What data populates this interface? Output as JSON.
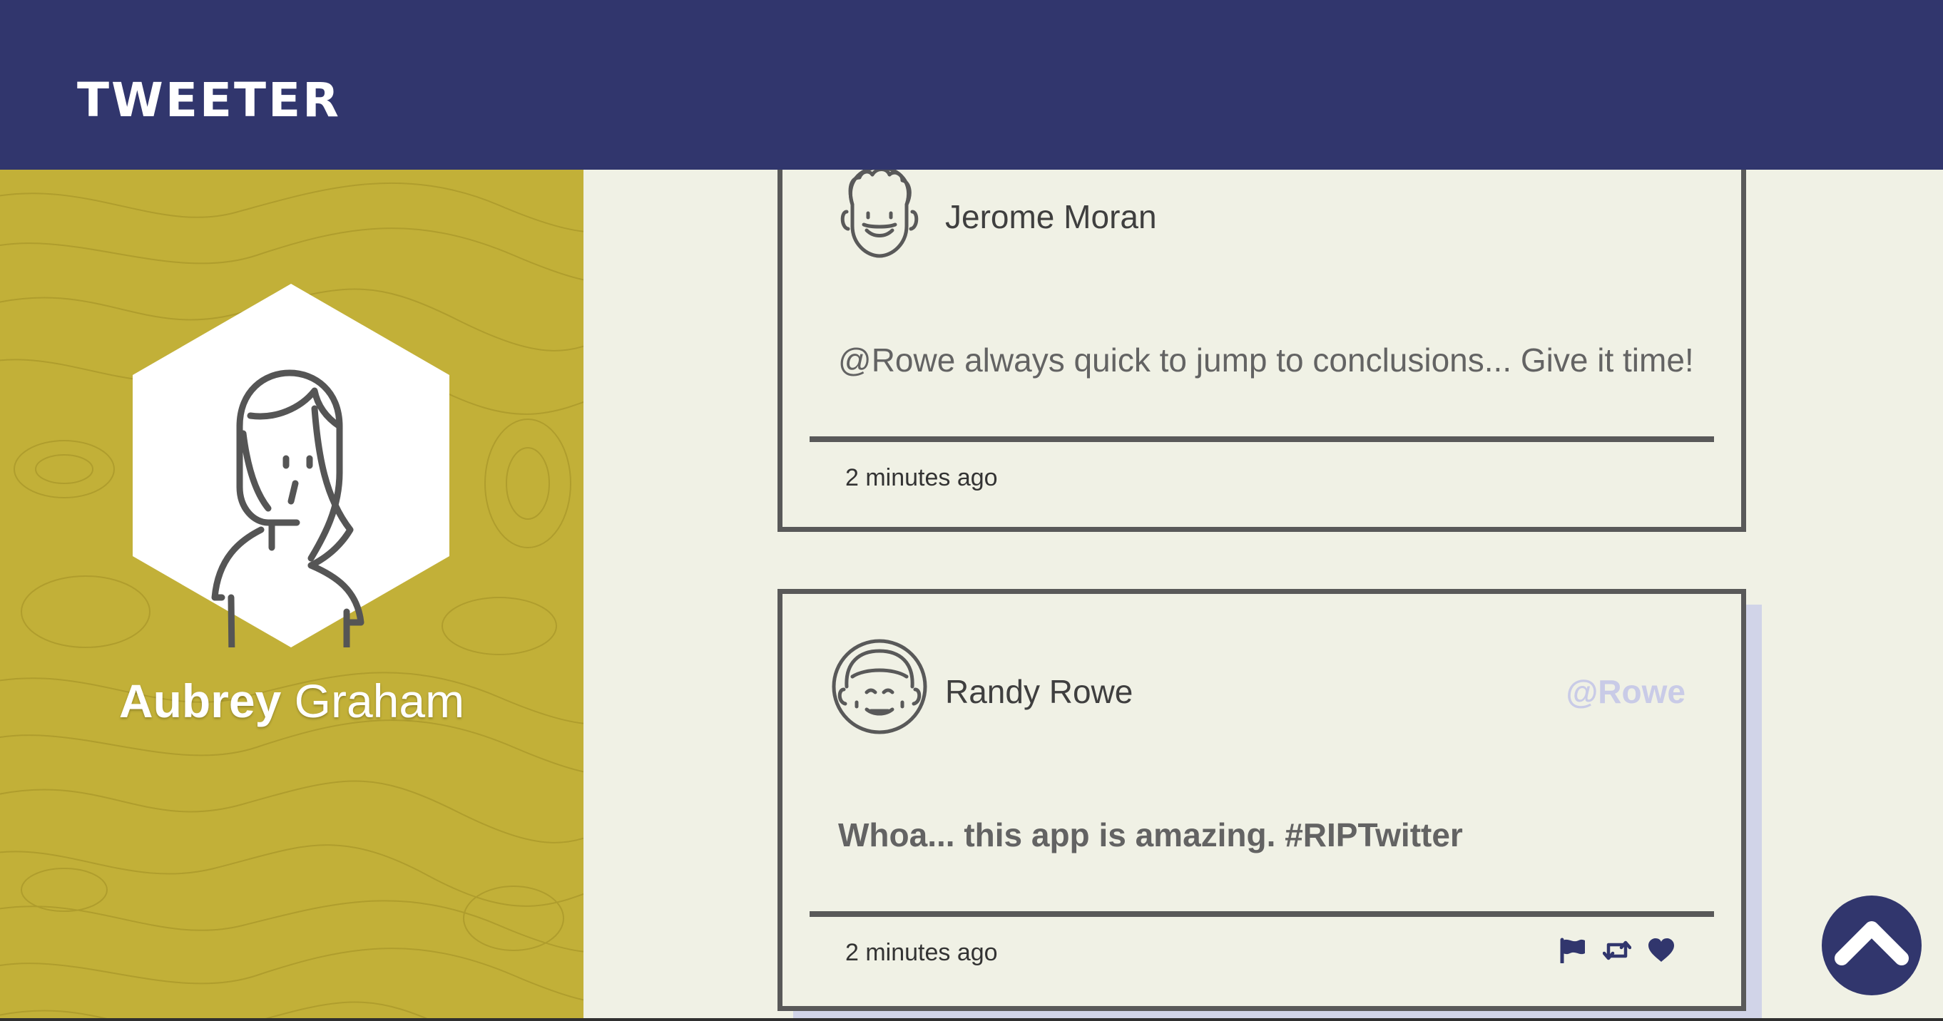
{
  "app": {
    "brand": "TWEETER"
  },
  "profile": {
    "first_name": "Aubrey",
    "last_name": "Graham"
  },
  "tweets": [
    {
      "author": "Jerome Moran",
      "handle": "",
      "text": "@Rowe always quick to jump to conclusions... Give it time!",
      "time": "2 minutes ago",
      "avatar_icon": "curly-hair-man-avatar-icon",
      "actions_visible": false
    },
    {
      "author": "Randy Rowe",
      "handle": "@Rowe",
      "text": "Whoa... this app is amazing. #RIPTwitter",
      "time": "2 minutes ago",
      "avatar_icon": "smiling-man-avatar-icon",
      "actions_visible": true
    }
  ],
  "actions": {
    "icons": [
      "flag-icon",
      "retweet-icon",
      "heart-icon"
    ]
  },
  "colors": {
    "nav": "#31366d",
    "sidebar": "#c2b038",
    "feed_background": "#f0f1e5",
    "card_border": "#595959",
    "handle": "#c9cbe7",
    "shadow": "#d1d4e8",
    "action_icon": "#31366d"
  },
  "scroll_top": {
    "icon": "chevron-up-icon"
  }
}
